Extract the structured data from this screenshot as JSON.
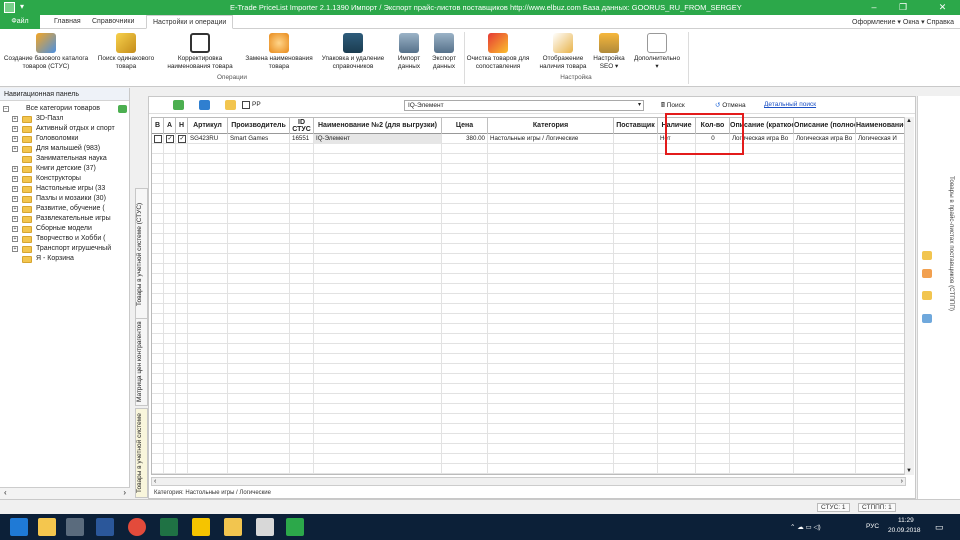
{
  "window": {
    "title": "E-Trade PriceList Importer 2.1.1390    Импорт / Экспорт прайс-листов поставщиков    http://www.elbuz.com    База данных: GOORUS_RU_FROM_SERGEY"
  },
  "menu": {
    "file": "Файл",
    "tabs": [
      "Главная",
      "Справочники",
      "Настройки и операции"
    ],
    "right": "Оформление ▾  Окна ▾  Справка"
  },
  "ribbon": {
    "buttons": [
      "Создание базового каталога товаров (СТУС)",
      "Поиск одинакового товара",
      "Корректировка наименования товара",
      "Замена наименования товара",
      "Упаковка и удаление справочников",
      "Импорт данных",
      "Экспорт данных",
      "Очистка товаров для сопоставления",
      "Отображение наличия товара",
      "Настройка SEO",
      "Дополнительно"
    ],
    "groups": {
      "operations": "Операции",
      "settings": "Настройка"
    }
  },
  "nav": {
    "title": "Навигационная панель",
    "root": "Все категории товаров",
    "items": [
      "3D-Пазл",
      "Активный отдых и спорт",
      "Головоломки",
      "Для малышей (983)",
      "Занимательная наука",
      "Книги детские (37)",
      "Конструкторы",
      "Настольные игры (33",
      "Пазлы и мозаики (30)",
      "Развитие, обучение (",
      "Развлекательные игры",
      "Сборные модели",
      "Творчество и Хобби (",
      "Транспорт игрушечный",
      "Я - Корзина"
    ]
  },
  "vertical_tabs": [
    "Товары в учетной системе (СТУС)",
    "Матрица цен контрагентов",
    "Товары в учетной системе"
  ],
  "toolbar": {
    "pp_label": "РР",
    "filter_value": "IQ-Элемент",
    "search": "Поиск",
    "cancel": "Отмена",
    "detailed_search": "Детальный поиск"
  },
  "grid": {
    "columns": [
      "В",
      "А",
      "Н",
      "Артикул",
      "Производитель",
      "ID СТУС",
      "Наименование №2 (для выгрузки)",
      "Цена",
      "Категория",
      "Поставщик",
      "Наличие",
      "Кол-во",
      "Описание (краткое)",
      "Описание (полное)",
      "Наименование"
    ],
    "rows": [
      {
        "checks": [
          false,
          true,
          true
        ],
        "article": "SG423RU",
        "maker": "Smart Games",
        "id": "16551",
        "name": "IQ-Элемент",
        "price": "380.00",
        "category": "Настольные игры / Логические",
        "supplier": "",
        "stock": "Нет",
        "qty": "0",
        "short_desc": "Логическая игра Во",
        "full_desc": "Логическая игра Во",
        "naming": "Логическая И"
      }
    ],
    "category_status": "Категория: Настольные игры / Логические"
  },
  "right_panel": {
    "label": "Товары в прайс-листах поставщиков (СТППП)"
  },
  "statusbar": {
    "stus": "СТУС: 1",
    "stpp": "СТППП: 1"
  },
  "taskbar": {
    "time": "11:29",
    "date": "20.09.2018",
    "lang": "РУС"
  },
  "colors": {
    "accent": "#2ca84a",
    "highlight": "#e31b1b",
    "taskbar": "#0c2038"
  }
}
